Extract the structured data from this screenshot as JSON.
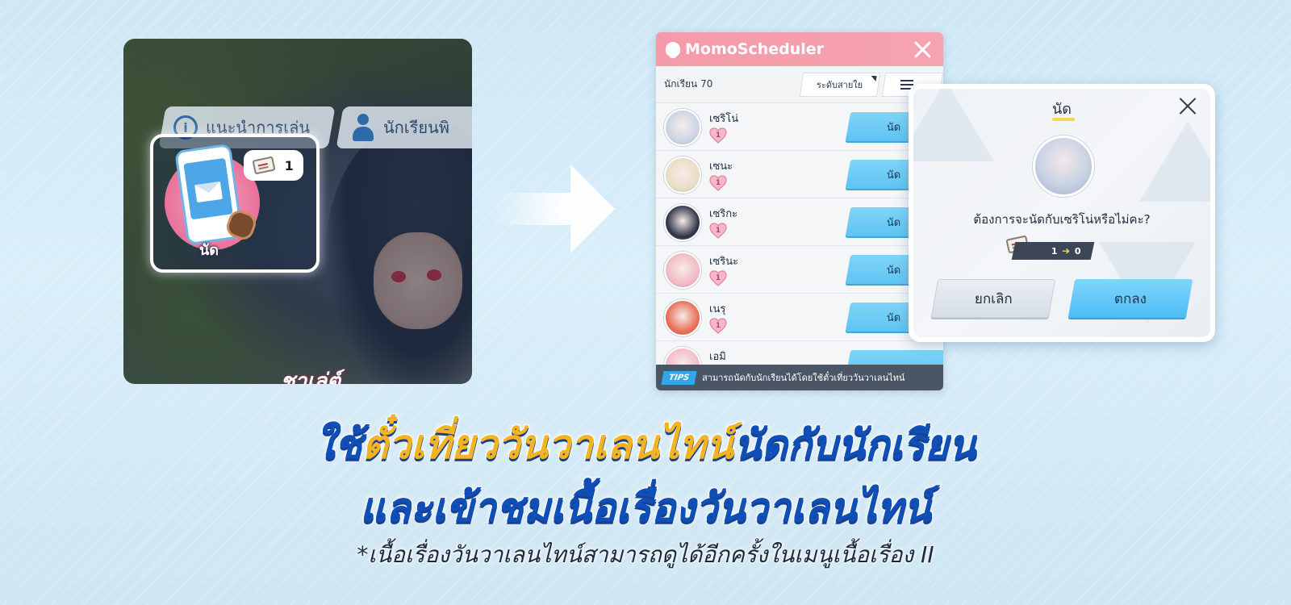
{
  "game_screen": {
    "guide_button": "แนะนำการเล่น",
    "student_button": "นักเรียนพิ",
    "date_tile_label": "นัด",
    "ticket_count": "1",
    "sign_text": "ชาเล่ต์"
  },
  "scheduler": {
    "title": "MomoScheduler",
    "student_count": "นักเรียน 70",
    "sort_label": "ระดับสายใย",
    "students": [
      {
        "name": "เซริโน่",
        "affection": "1",
        "button": "นัด",
        "color": "#c9d3e4"
      },
      {
        "name": "เซนะ",
        "affection": "1",
        "button": "นัด",
        "color": "#e9dcc4"
      },
      {
        "name": "เซริกะ",
        "affection": "1",
        "button": "นัด",
        "color": "#2a2f44"
      },
      {
        "name": "เซรินะ",
        "affection": "1",
        "button": "นัด",
        "color": "#f2b6c2"
      },
      {
        "name": "เนรุ",
        "affection": "1",
        "button": "นัด",
        "color": "#e8684f"
      },
      {
        "name": "เอมิ",
        "affection": "",
        "button": "",
        "color": "#f4b8c8"
      }
    ],
    "tips_badge": "TIPS",
    "tips_text": "สามารถนัดกับนักเรียนได้โดยใช้ตั๋วเที่ยววันวาเลนไทน์"
  },
  "confirm_dialog": {
    "title": "นัด",
    "message": "ต้องการจะนัดกับเซริโน่หรือไม่คะ?",
    "ticket_from": "1",
    "ticket_arrow": "➔",
    "ticket_to": "0",
    "cancel_label": "ยกเลิก",
    "ok_label": "ตกลง"
  },
  "caption": {
    "line1_part1": "ใช้",
    "line1_highlight": "ตั๋วเที่ยววันวาเลนไทน์",
    "line1_part2": "นัดกับนักเรียน",
    "line2": "และเข้าชมเนื้อเรื่องวันวาเลนไทน์",
    "note": "*เนื้อเรื่องวันวาเลนไทน์สามารถดูได้อีกครั้งในเมนูเนื้อเรื่อง II"
  },
  "colors": {
    "accent_blue": "#5ec4f3",
    "header_pink": "#f59aa8",
    "caption_blue": "#0e4fb8",
    "caption_highlight": "#f3b423"
  }
}
